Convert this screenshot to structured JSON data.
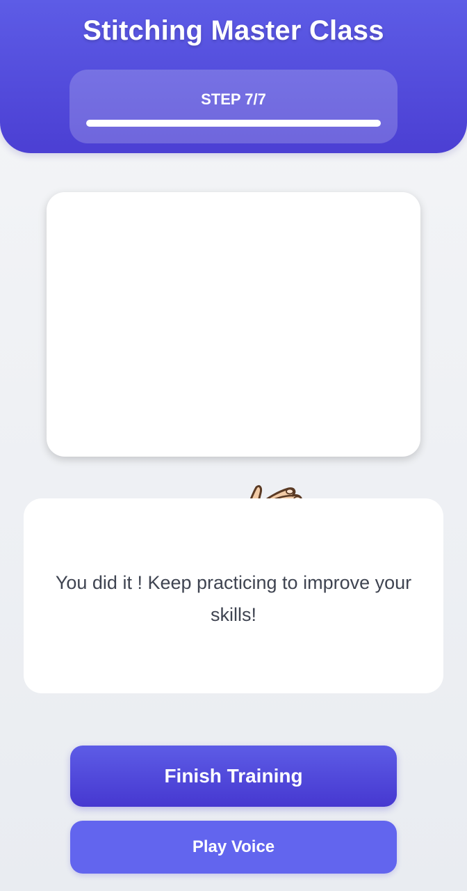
{
  "app": {
    "title": "Stitching Master Class"
  },
  "progress": {
    "step_label": "STEP 7/7",
    "current_step": 7,
    "total_steps": 7,
    "fraction": 1.0
  },
  "illustration": {
    "icon": "clapping-hands-icon"
  },
  "message": {
    "text": "You did it ! Keep practicing to improve your skills!"
  },
  "actions": {
    "finish_label": "Finish Training",
    "voice_label": "Play Voice"
  },
  "colors": {
    "accent": "#5d5ce6",
    "accent_dark": "#4638d0",
    "secondary_button": "#6265ee",
    "text": "#3f4451"
  }
}
